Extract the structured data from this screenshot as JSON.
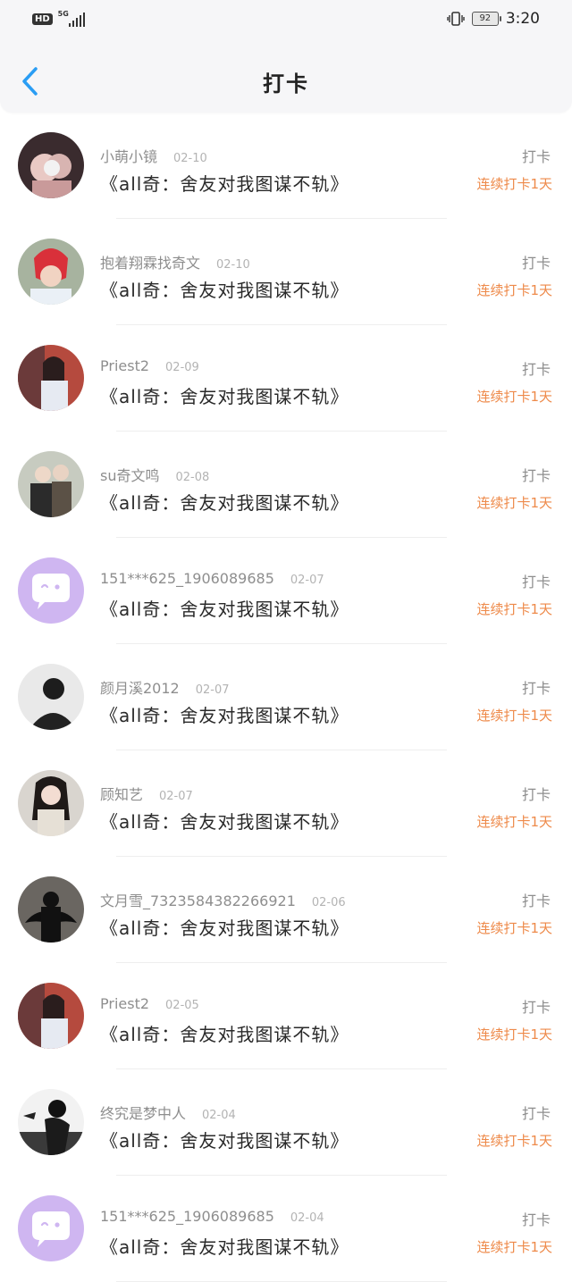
{
  "status": {
    "net_type": "HD",
    "signal": "5G",
    "battery": "92",
    "time": "3:20"
  },
  "header": {
    "title": "打卡"
  },
  "entries": [
    {
      "user": "小萌小镜",
      "date": "02-10",
      "book": "《all奇：舍友对我图谋不轨》",
      "action": "打卡",
      "streak": "连续打卡1天",
      "avatar": "photo-1"
    },
    {
      "user": "抱着翔霖找奇文",
      "date": "02-10",
      "book": "《all奇：舍友对我图谋不轨》",
      "action": "打卡",
      "streak": "连续打卡1天",
      "avatar": "photo-2"
    },
    {
      "user": "Priest2",
      "date": "02-09",
      "book": "《all奇：舍友对我图谋不轨》",
      "action": "打卡",
      "streak": "连续打卡1天",
      "avatar": "photo-3"
    },
    {
      "user": "su奇文鸣",
      "date": "02-08",
      "book": "《all奇：舍友对我图谋不轨》",
      "action": "打卡",
      "streak": "连续打卡1天",
      "avatar": "photo-4"
    },
    {
      "user": "151***625_1906089685",
      "date": "02-07",
      "book": "《all奇：舍友对我图谋不轨》",
      "action": "打卡",
      "streak": "连续打卡1天",
      "avatar": "default-chat"
    },
    {
      "user": "颜月溪2012",
      "date": "02-07",
      "book": "《all奇：舍友对我图谋不轨》",
      "action": "打卡",
      "streak": "连续打卡1天",
      "avatar": "photo-5"
    },
    {
      "user": "顾知艺",
      "date": "02-07",
      "book": "《all奇：舍友对我图谋不轨》",
      "action": "打卡",
      "streak": "连续打卡1天",
      "avatar": "photo-6"
    },
    {
      "user": "文月雪_7323584382266921",
      "date": "02-06",
      "book": "《all奇：舍友对我图谋不轨》",
      "action": "打卡",
      "streak": "连续打卡1天",
      "avatar": "photo-7"
    },
    {
      "user": "Priest2",
      "date": "02-05",
      "book": "《all奇：舍友对我图谋不轨》",
      "action": "打卡",
      "streak": "连续打卡1天",
      "avatar": "photo-3"
    },
    {
      "user": "终究是梦中人",
      "date": "02-04",
      "book": "《all奇：舍友对我图谋不轨》",
      "action": "打卡",
      "streak": "连续打卡1天",
      "avatar": "photo-8"
    },
    {
      "user": "151***625_1906089685",
      "date": "02-04",
      "book": "《all奇：舍友对我图谋不轨》",
      "action": "打卡",
      "streak": "连续打卡1天",
      "avatar": "default-chat"
    }
  ],
  "colors": {
    "accent": "#2a9df4",
    "streak": "#ee8a4a",
    "secondary_text": "#8e8e8e",
    "default_avatar_bg": "#cfb6f1"
  }
}
